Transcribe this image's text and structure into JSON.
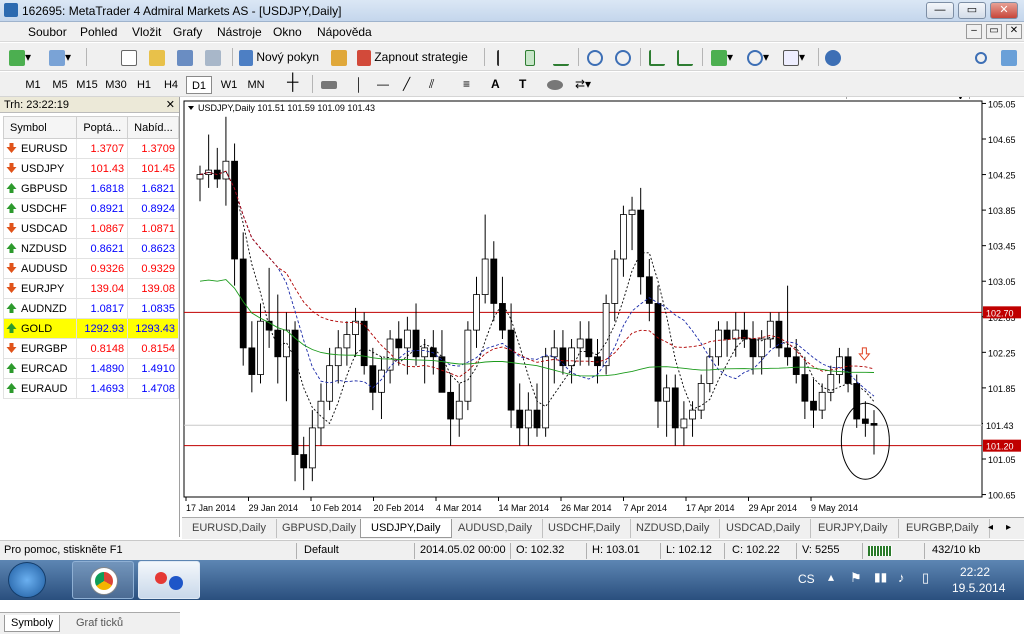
{
  "window": {
    "title": "162695: MetaTrader 4 Admiral Markets AS - [USDJPY,Daily]",
    "btn_min": "—",
    "btn_max": "▭",
    "btn_close": "✕"
  },
  "menu": [
    "Soubor",
    "Pohled",
    "Vložit",
    "Grafy",
    "Nástroje",
    "Okno",
    "Nápověda"
  ],
  "toolbar": {
    "new_order": "Nový pokyn",
    "strategy": "Zapnout strategie"
  },
  "timeframes": [
    "M1",
    "M5",
    "M15",
    "M30",
    "H1",
    "H4",
    "D1",
    "W1",
    "MN"
  ],
  "active_timeframe": "D1",
  "market_watch": {
    "header": "Trh: 23:22:19",
    "col_symbol": "Symbol",
    "col_bid": "Poptá...",
    "col_ask": "Nabíd...",
    "rows": [
      {
        "symbol": "EURUSD",
        "bid": "1.3707",
        "ask": "1.3709",
        "dir": "down"
      },
      {
        "symbol": "USDJPY",
        "bid": "101.43",
        "ask": "101.45",
        "dir": "down"
      },
      {
        "symbol": "GBPUSD",
        "bid": "1.6818",
        "ask": "1.6821",
        "dir": "up"
      },
      {
        "symbol": "USDCHF",
        "bid": "0.8921",
        "ask": "0.8924",
        "dir": "up"
      },
      {
        "symbol": "USDCAD",
        "bid": "1.0867",
        "ask": "1.0871",
        "dir": "down"
      },
      {
        "symbol": "NZDUSD",
        "bid": "0.8621",
        "ask": "0.8623",
        "dir": "up"
      },
      {
        "symbol": "AUDUSD",
        "bid": "0.9326",
        "ask": "0.9329",
        "dir": "down"
      },
      {
        "symbol": "EURJPY",
        "bid": "139.04",
        "ask": "139.08",
        "dir": "down"
      },
      {
        "symbol": "AUDNZD",
        "bid": "1.0817",
        "ask": "1.0835",
        "dir": "up"
      },
      {
        "symbol": "GOLD",
        "bid": "1292.93",
        "ask": "1293.43",
        "dir": "up",
        "highlight": true
      },
      {
        "symbol": "EURGBP",
        "bid": "0.8148",
        "ask": "0.8154",
        "dir": "down"
      },
      {
        "symbol": "EURCAD",
        "bid": "1.4890",
        "ask": "1.4910",
        "dir": "up"
      },
      {
        "symbol": "EURAUD",
        "bid": "1.4693",
        "ask": "1.4708",
        "dir": "up"
      }
    ],
    "tab_symbols": "Symboly",
    "tab_ticks": "Graf ticků"
  },
  "chart": {
    "info": "USDJPY,Daily  101.51 101.59 101.09 101.43",
    "ylabels": [
      "105.05",
      "104.65",
      "104.25",
      "103.85",
      "103.45",
      "103.05",
      "102.65",
      "102.25",
      "101.85",
      "101.45",
      "101.05",
      "100.65"
    ],
    "xlabels": [
      "17 Jan 2014",
      "29 Jan 2014",
      "10 Feb 2014",
      "20 Feb 2014",
      "4 Mar 2014",
      "14 Mar 2014",
      "26 Mar 2014",
      "7 Apr 2014",
      "17 Apr 2014",
      "29 Apr 2014",
      "9 May 2014"
    ],
    "price_tag": "101.43",
    "line_upper": "102.70",
    "line_lower": "101.20"
  },
  "chart_data": {
    "type": "candlestick",
    "ylim": [
      100.6,
      105.1
    ],
    "candles": [
      [
        104.2,
        104.35,
        103.95,
        104.25
      ],
      [
        104.25,
        104.7,
        104.1,
        104.3
      ],
      [
        104.3,
        104.55,
        104.1,
        104.2
      ],
      [
        104.2,
        104.9,
        103.9,
        104.4
      ],
      [
        104.4,
        104.6,
        103.0,
        103.3
      ],
      [
        103.3,
        103.6,
        102.1,
        102.3
      ],
      [
        102.3,
        102.6,
        101.8,
        102.0
      ],
      [
        102.0,
        102.8,
        101.9,
        102.6
      ],
      [
        102.6,
        103.2,
        102.3,
        102.5
      ],
      [
        102.5,
        102.9,
        101.9,
        102.2
      ],
      [
        102.2,
        102.7,
        101.7,
        102.5
      ],
      [
        102.5,
        102.6,
        100.8,
        101.1
      ],
      [
        101.1,
        101.3,
        100.7,
        100.95
      ],
      [
        100.95,
        101.6,
        100.8,
        101.4
      ],
      [
        101.4,
        101.9,
        101.2,
        101.7
      ],
      [
        101.7,
        102.3,
        101.6,
        102.1
      ],
      [
        102.1,
        102.5,
        101.9,
        102.3
      ],
      [
        102.3,
        102.6,
        102.1,
        102.45
      ],
      [
        102.45,
        102.75,
        102.2,
        102.6
      ],
      [
        102.6,
        102.7,
        102.0,
        102.1
      ],
      [
        102.1,
        102.3,
        101.6,
        101.8
      ],
      [
        101.8,
        102.2,
        101.5,
        102.05
      ],
      [
        102.05,
        102.5,
        101.9,
        102.4
      ],
      [
        102.4,
        102.6,
        102.1,
        102.3
      ],
      [
        102.3,
        102.65,
        102.0,
        102.5
      ],
      [
        102.5,
        102.8,
        102.1,
        102.2
      ],
      [
        102.2,
        102.4,
        101.9,
        102.3
      ],
      [
        102.3,
        102.5,
        102.0,
        102.2
      ],
      [
        102.2,
        102.5,
        101.9,
        101.8
      ],
      [
        101.8,
        102.0,
        101.2,
        101.5
      ],
      [
        101.5,
        101.9,
        101.3,
        101.7
      ],
      [
        101.7,
        102.6,
        101.6,
        102.5
      ],
      [
        102.5,
        103.1,
        102.3,
        102.9
      ],
      [
        102.9,
        103.8,
        102.8,
        103.3
      ],
      [
        103.3,
        103.5,
        102.6,
        102.8
      ],
      [
        102.8,
        103.1,
        102.4,
        102.5
      ],
      [
        102.5,
        102.8,
        101.4,
        101.6
      ],
      [
        101.6,
        101.9,
        101.2,
        101.4
      ],
      [
        101.4,
        101.8,
        101.2,
        101.6
      ],
      [
        101.6,
        101.9,
        101.3,
        101.4
      ],
      [
        101.4,
        102.3,
        101.3,
        102.2
      ],
      [
        102.2,
        102.5,
        101.9,
        102.3
      ],
      [
        102.3,
        102.5,
        102.0,
        102.1
      ],
      [
        102.1,
        102.4,
        101.9,
        102.3
      ],
      [
        102.3,
        102.6,
        102.1,
        102.4
      ],
      [
        102.4,
        102.6,
        102.1,
        102.2
      ],
      [
        102.2,
        102.4,
        101.9,
        102.1
      ],
      [
        102.1,
        102.9,
        102.0,
        102.8
      ],
      [
        102.8,
        103.4,
        102.6,
        103.3
      ],
      [
        103.3,
        103.9,
        103.1,
        103.8
      ],
      [
        103.8,
        104.0,
        103.4,
        103.85
      ],
      [
        103.85,
        104.1,
        102.9,
        103.1
      ],
      [
        103.1,
        103.3,
        102.6,
        102.8
      ],
      [
        102.8,
        103.0,
        101.4,
        101.7
      ],
      [
        101.7,
        102.0,
        101.3,
        101.85
      ],
      [
        101.85,
        102.0,
        101.2,
        101.4
      ],
      [
        101.4,
        101.7,
        101.2,
        101.5
      ],
      [
        101.5,
        101.7,
        101.3,
        101.6
      ],
      [
        101.6,
        102.0,
        101.5,
        101.9
      ],
      [
        101.9,
        102.3,
        101.8,
        102.2
      ],
      [
        102.2,
        102.6,
        102.1,
        102.5
      ],
      [
        102.5,
        102.6,
        102.2,
        102.4
      ],
      [
        102.4,
        102.7,
        102.2,
        102.5
      ],
      [
        102.5,
        102.7,
        102.3,
        102.4
      ],
      [
        102.4,
        102.6,
        102.0,
        102.2
      ],
      [
        102.2,
        102.5,
        102.0,
        102.4
      ],
      [
        102.4,
        102.7,
        102.3,
        102.6
      ],
      [
        102.6,
        102.7,
        102.2,
        102.3
      ],
      [
        102.3,
        103.0,
        102.1,
        102.2
      ],
      [
        102.2,
        102.4,
        101.9,
        102.0
      ],
      [
        102.0,
        102.2,
        101.5,
        101.7
      ],
      [
        101.7,
        101.95,
        101.4,
        101.6
      ],
      [
        101.6,
        101.9,
        101.5,
        101.8
      ],
      [
        101.8,
        102.1,
        101.7,
        102.0
      ],
      [
        102.0,
        102.3,
        101.9,
        102.2
      ],
      [
        102.2,
        102.3,
        101.8,
        101.9
      ],
      [
        101.9,
        102.0,
        101.4,
        101.5
      ],
      [
        101.5,
        101.7,
        101.3,
        101.45
      ],
      [
        101.45,
        101.6,
        101.1,
        101.43
      ]
    ]
  }
}
